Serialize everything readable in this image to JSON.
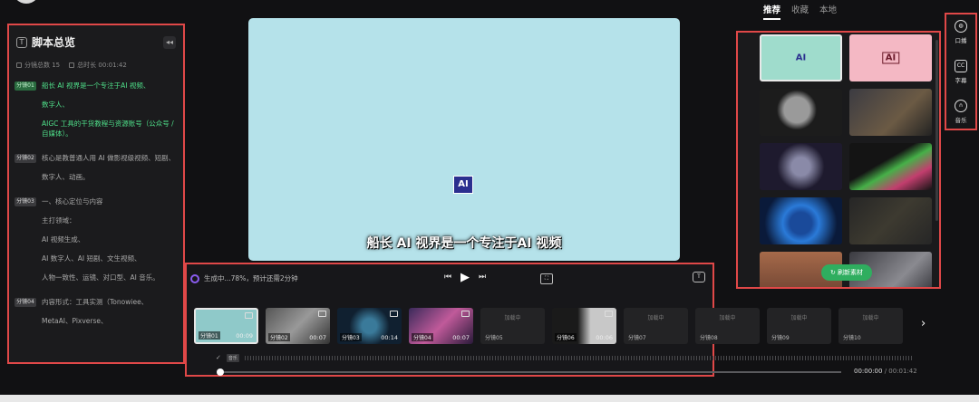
{
  "script_panel": {
    "title": "脚本总览",
    "segments_total": "分镜总数 15",
    "duration_total": "总时长 00:01:42",
    "segments": [
      {
        "badge": "分镜01",
        "active": true,
        "lines": [
          "船长 AI 视界是一个专注于AI 视频、",
          "数字人、",
          "AIGC 工具的干货教程与资源账号（公众号 / 自媒体）。"
        ]
      },
      {
        "badge": "分镜02",
        "active": false,
        "lines": [
          "核心是教普通人用 AI 做影视级视频、短剧、",
          "数字人、动画。"
        ]
      },
      {
        "badge": "分镜03",
        "active": false,
        "lines": [
          "一、核心定位与内容",
          "主打领域：",
          "AI 视频生成、",
          "AI 数字人、AI 短剧、文生视频、",
          "人物一致性、运镜、对口型、AI 音乐。"
        ]
      },
      {
        "badge": "分镜04",
        "active": false,
        "lines": [
          "内容形式：工具实测（Tonowiee、",
          "MetaAI、Pixverse、"
        ]
      }
    ]
  },
  "preview": {
    "logo_text": "AI",
    "subtitle": "船长 AI 视界是一个专注于AI 视频"
  },
  "player": {
    "status": "生成中...78%，预计还需2分钟",
    "progress_percent": 78,
    "time_current": "00:00:00",
    "time_total": "/ 00:01:42",
    "audio_badge": "音乐"
  },
  "clips": [
    {
      "label": "分镜01",
      "duration": "00:09",
      "state": "ready",
      "selected": true
    },
    {
      "label": "分镜02",
      "duration": "00:07",
      "state": "ready",
      "selected": false
    },
    {
      "label": "分镜03",
      "duration": "00:14",
      "state": "ready",
      "selected": false
    },
    {
      "label": "分镜04",
      "duration": "00:07",
      "state": "ready",
      "selected": false
    },
    {
      "label": "分镜05",
      "duration": "",
      "state": "loading",
      "loading_text": "加载中",
      "selected": false
    },
    {
      "label": "分镜06",
      "duration": "00:06",
      "state": "ready",
      "selected": false
    },
    {
      "label": "分镜07",
      "duration": "",
      "state": "loading",
      "loading_text": "加载中",
      "selected": false
    },
    {
      "label": "分镜08",
      "duration": "",
      "state": "loading",
      "loading_text": "加载中",
      "selected": false
    },
    {
      "label": "分镜09",
      "duration": "",
      "state": "loading",
      "loading_text": "加载中",
      "selected": false
    },
    {
      "label": "分镜10",
      "duration": "",
      "state": "loading",
      "loading_text": "加载中",
      "selected": false
    }
  ],
  "material_panel": {
    "tabs": [
      {
        "label": "推荐",
        "active": true
      },
      {
        "label": "收藏",
        "active": false
      },
      {
        "label": "本地",
        "active": false
      }
    ],
    "tile_marks": [
      "AI",
      "AI"
    ],
    "refresh_label": "刷新素材"
  },
  "toolbar": {
    "items": [
      {
        "label": "口播",
        "icon": "microphone-icon",
        "glyph": "◍"
      },
      {
        "label": "字幕",
        "icon": "cc-icon",
        "glyph": "CC"
      },
      {
        "label": "音乐",
        "icon": "headphones-icon",
        "glyph": "∩"
      }
    ]
  },
  "colors": {
    "highlight_border": "#e04848",
    "active_text": "#4fe08a",
    "preview_bg": "#b5e2ea",
    "refresh_button": "#2fae5f"
  }
}
